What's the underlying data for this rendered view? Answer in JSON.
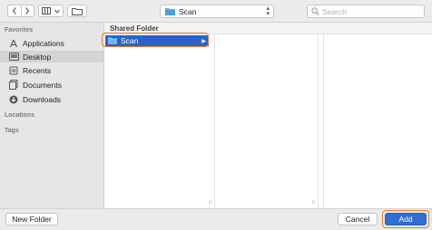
{
  "toolbar": {
    "back_icon": "chevron-left-icon",
    "forward_icon": "chevron-right-icon",
    "view_icon": "column-view-icon",
    "new_folder_icon": "new-folder-icon",
    "location_value": "Scan",
    "location_icon": "folder-icon",
    "search_placeholder": "Search"
  },
  "sidebar": {
    "favorites_heading": "Favorites",
    "items": [
      {
        "label": "Applications",
        "icon": "applications-icon"
      },
      {
        "label": "Desktop",
        "icon": "desktop-icon",
        "selected": true
      },
      {
        "label": "Recents",
        "icon": "recents-icon"
      },
      {
        "label": "Documents",
        "icon": "documents-icon"
      },
      {
        "label": "Downloads",
        "icon": "downloads-icon"
      }
    ],
    "locations_heading": "Locations",
    "tags_heading": "Tags"
  },
  "browser": {
    "column_header": "Shared Folder",
    "selected_item": "Scan"
  },
  "footer": {
    "new_folder_label": "New Folder",
    "cancel_label": "Cancel",
    "add_label": "Add"
  },
  "colors": {
    "selection": "#2a62c9",
    "highlight": "#e97a2a",
    "primary_button": "#2f6fd6"
  }
}
